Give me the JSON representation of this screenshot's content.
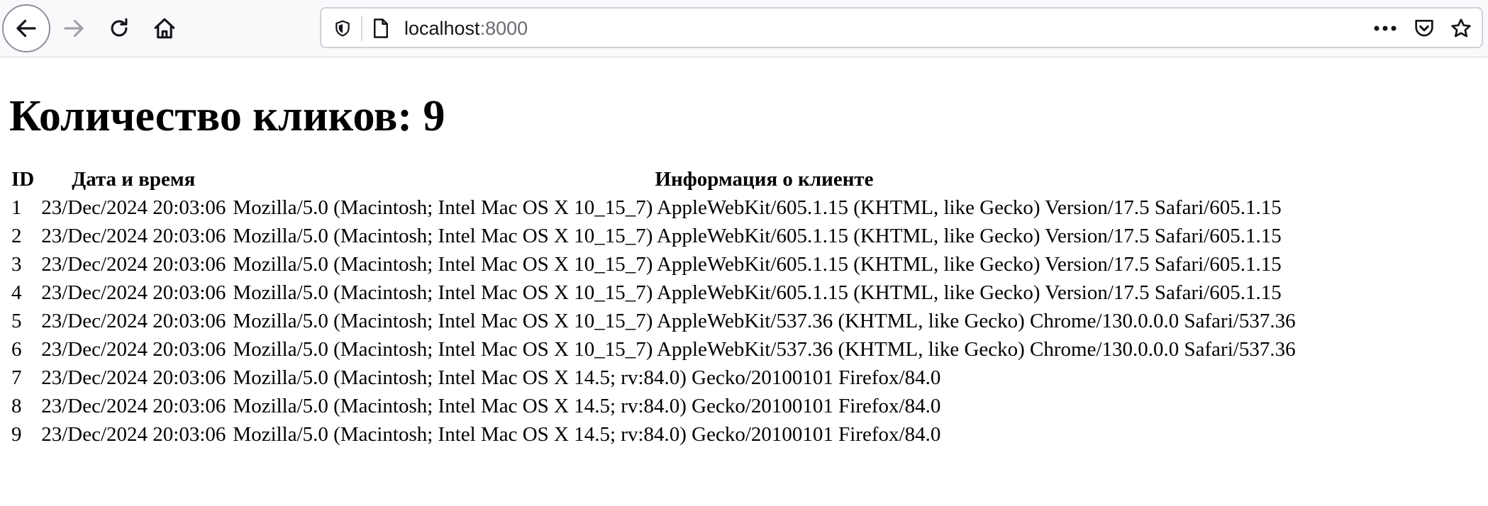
{
  "browser": {
    "url_host": "localhost",
    "url_port": ":8000",
    "icons": {
      "back": "back-arrow-icon",
      "forward": "forward-arrow-icon",
      "reload": "reload-icon",
      "home": "home-icon",
      "shield": "shield-icon",
      "page": "page-icon",
      "more": "more-dots-icon",
      "pocket": "pocket-icon",
      "bookmark": "star-icon"
    }
  },
  "page": {
    "heading": "Количество кликов: 9",
    "table": {
      "headers": [
        "ID",
        "Дата и время",
        "Информация о клиенте"
      ],
      "rows": [
        [
          "1",
          "23/Dec/2024 20:03:06",
          "Mozilla/5.0 (Macintosh; Intel Mac OS X 10_15_7) AppleWebKit/605.1.15 (KHTML, like Gecko) Version/17.5 Safari/605.1.15"
        ],
        [
          "2",
          "23/Dec/2024 20:03:06",
          "Mozilla/5.0 (Macintosh; Intel Mac OS X 10_15_7) AppleWebKit/605.1.15 (KHTML, like Gecko) Version/17.5 Safari/605.1.15"
        ],
        [
          "3",
          "23/Dec/2024 20:03:06",
          "Mozilla/5.0 (Macintosh; Intel Mac OS X 10_15_7) AppleWebKit/605.1.15 (KHTML, like Gecko) Version/17.5 Safari/605.1.15"
        ],
        [
          "4",
          "23/Dec/2024 20:03:06",
          "Mozilla/5.0 (Macintosh; Intel Mac OS X 10_15_7) AppleWebKit/605.1.15 (KHTML, like Gecko) Version/17.5 Safari/605.1.15"
        ],
        [
          "5",
          "23/Dec/2024 20:03:06",
          "Mozilla/5.0 (Macintosh; Intel Mac OS X 10_15_7) AppleWebKit/537.36 (KHTML, like Gecko) Chrome/130.0.0.0 Safari/537.36"
        ],
        [
          "6",
          "23/Dec/2024 20:03:06",
          "Mozilla/5.0 (Macintosh; Intel Mac OS X 10_15_7) AppleWebKit/537.36 (KHTML, like Gecko) Chrome/130.0.0.0 Safari/537.36"
        ],
        [
          "7",
          "23/Dec/2024 20:03:06",
          "Mozilla/5.0 (Macintosh; Intel Mac OS X 14.5; rv:84.0) Gecko/20100101 Firefox/84.0"
        ],
        [
          "8",
          "23/Dec/2024 20:03:06",
          "Mozilla/5.0 (Macintosh; Intel Mac OS X 14.5; rv:84.0) Gecko/20100101 Firefox/84.0"
        ],
        [
          "9",
          "23/Dec/2024 20:03:06",
          "Mozilla/5.0 (Macintosh; Intel Mac OS X 14.5; rv:84.0) Gecko/20100101 Firefox/84.0"
        ]
      ]
    }
  },
  "colors": {
    "toolbar_bg": "#f9f9fb",
    "icon": "#15141a",
    "icon_disabled": "#a2a2a8",
    "url_port": "#6b6b74"
  }
}
